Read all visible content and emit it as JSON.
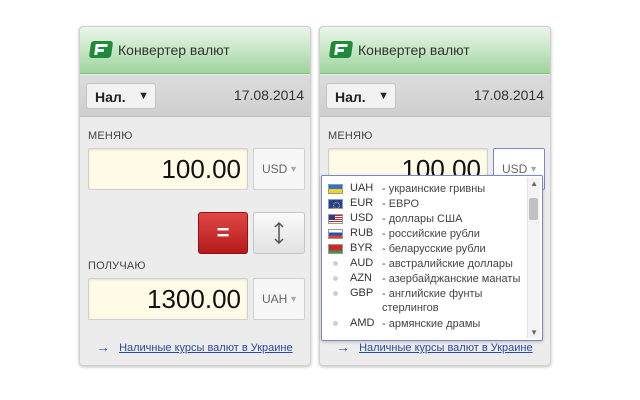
{
  "widgets": [
    {
      "title": "Конвертер валют",
      "cash_type": "Нал.",
      "date": "17.08.2014",
      "give_label": "МЕНЯЮ",
      "give_amount": "100.00",
      "give_currency": "USD",
      "equals_label": "=",
      "receive_label": "ПОЛУЧАЮ",
      "receive_amount": "1300.00",
      "receive_currency": "UAH",
      "link_text": "Наличные курсы валют в Украине"
    },
    {
      "title": "Конвертер валют",
      "cash_type": "Нал.",
      "date": "17.08.2014",
      "give_label": "МЕНЯЮ",
      "give_amount": "100.00",
      "give_currency": "USD",
      "link_text": "Наличные курсы валют в Украине"
    }
  ],
  "dropdown": {
    "items": [
      {
        "code": "UAH",
        "name": "- украинские гривны",
        "flag": "ua"
      },
      {
        "code": "EUR",
        "name": "- ЕВРО",
        "flag": "eu"
      },
      {
        "code": "USD",
        "name": "- доллары США",
        "flag": "us"
      },
      {
        "code": "RUB",
        "name": "- российские рубли",
        "flag": "ru"
      },
      {
        "code": "BYR",
        "name": "- беларусские рубли",
        "flag": "by"
      },
      {
        "code": "AUD",
        "name": "- австралийские доллары",
        "flag": "none"
      },
      {
        "code": "AZN",
        "name": "- азербайджанские манаты",
        "flag": "none"
      },
      {
        "code": "GBP",
        "name": "- английские фунты стерлингов",
        "flag": "none"
      },
      {
        "code": "AMD",
        "name": "- армянские драмы",
        "flag": "none"
      }
    ]
  },
  "icons": {
    "logo": "forex-logo-icon",
    "select_arrow": "triangle-down-icon",
    "swap": "vertical-swap-arrows-icon",
    "link_arrow": "arrow-right-icon"
  },
  "colors": {
    "header_green": "#9fd49f",
    "equals_red": "#c82828",
    "amount_bg": "#fffbe6",
    "link_blue": "#2a4aa0"
  }
}
